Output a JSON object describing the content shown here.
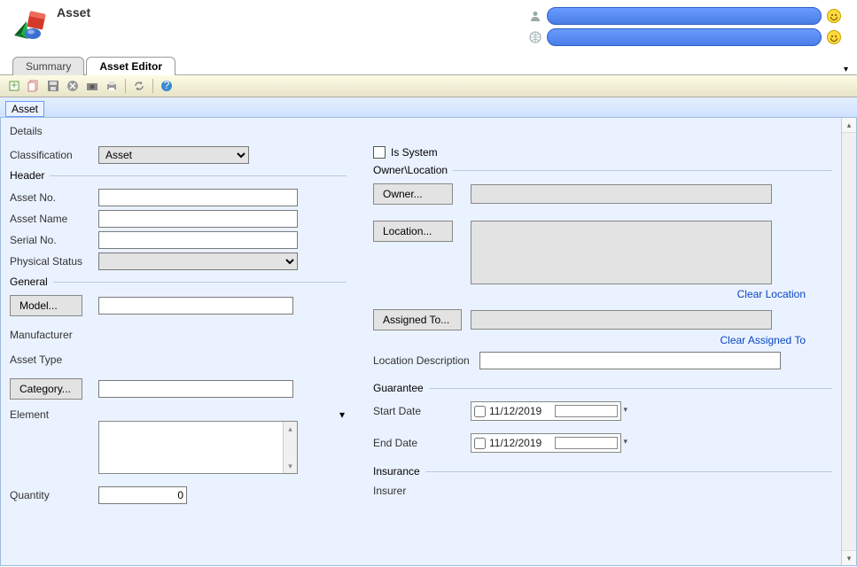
{
  "title": "Asset",
  "tabs": {
    "summary": "Summary",
    "editor": "Asset Editor"
  },
  "subtab": "Asset",
  "details_title": "Details",
  "classification": {
    "label": "Classification",
    "value": "Asset"
  },
  "is_system_label": "Is System",
  "header_section": "Header",
  "header": {
    "asset_no": "Asset No.",
    "asset_name": "Asset Name",
    "serial_no": "Serial No.",
    "physical_status": "Physical Status"
  },
  "general_section": "General",
  "general": {
    "model_btn": "Model...",
    "manufacturer": "Manufacturer",
    "asset_type": "Asset Type",
    "category_btn": "Category...",
    "element": "Element",
    "quantity": "Quantity",
    "quantity_value": "0"
  },
  "owner_section": "Owner\\Location",
  "owner": {
    "owner_btn": "Owner...",
    "location_btn": "Location...",
    "clear_location": "Clear Location",
    "assigned_btn": "Assigned To...",
    "clear_assigned": "Clear Assigned To",
    "loc_desc": "Location Description"
  },
  "guarantee_section": "Guarantee",
  "guarantee": {
    "start": "Start Date",
    "end": "End Date",
    "date_value": "11/12/2019"
  },
  "insurance_section": "Insurance",
  "insurance": {
    "insurer": "Insurer"
  }
}
